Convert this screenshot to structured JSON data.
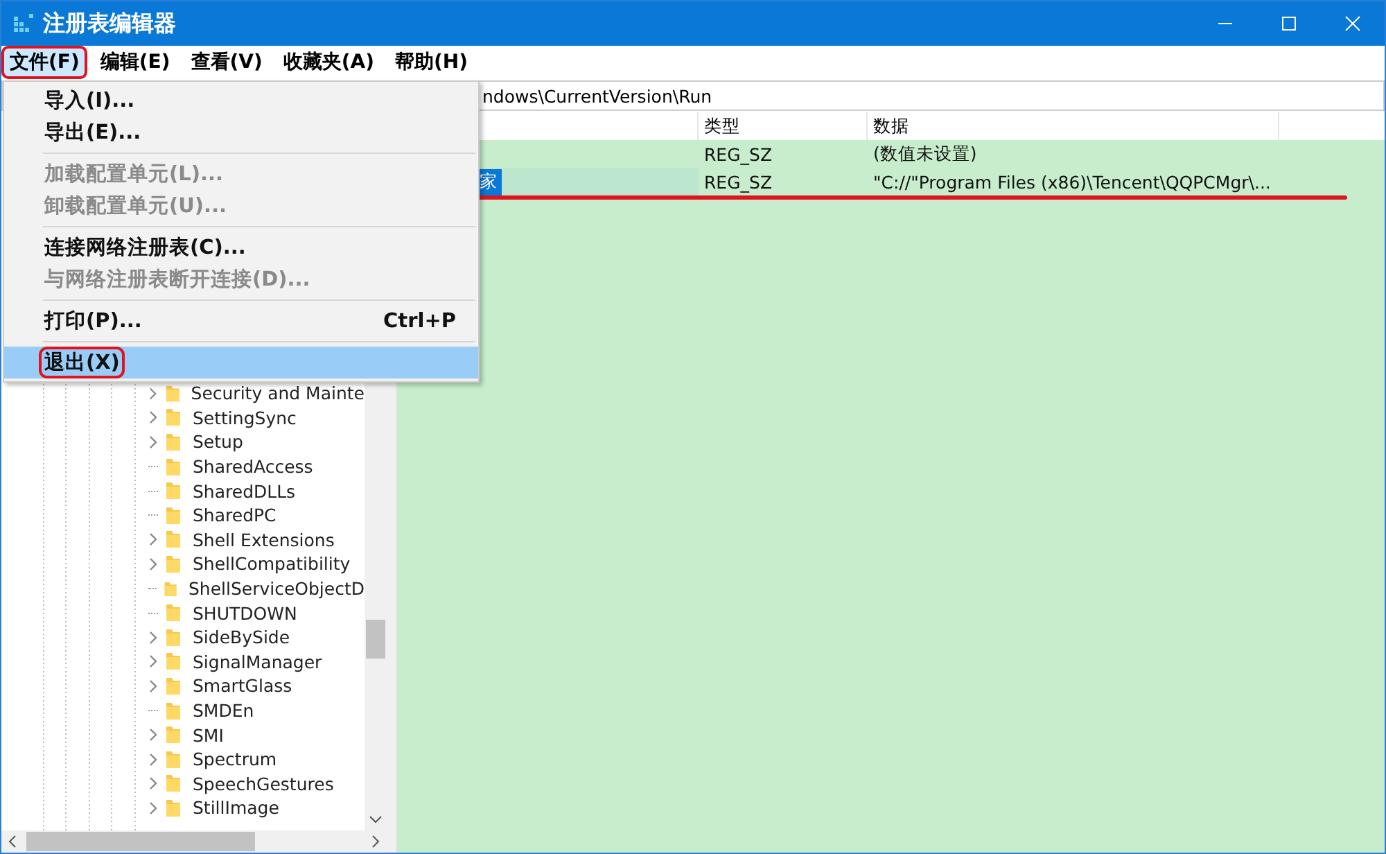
{
  "window": {
    "title": "注册表编辑器"
  },
  "menu_bar": [
    {
      "label": "文件(F)",
      "selected": true,
      "annotated": true
    },
    {
      "label": "编辑(E)",
      "selected": false,
      "annotated": false
    },
    {
      "label": "查看(V)",
      "selected": false,
      "annotated": false
    },
    {
      "label": "收藏夹(A)",
      "selected": false,
      "annotated": false
    },
    {
      "label": "帮助(H)",
      "selected": false,
      "annotated": false
    }
  ],
  "address_bar": {
    "value": "ndows\\CurrentVersion\\Run"
  },
  "tree": {
    "items": [
      {
        "label": "Security and Mainte",
        "expandable": true
      },
      {
        "label": "SettingSync",
        "expandable": true
      },
      {
        "label": "Setup",
        "expandable": true
      },
      {
        "label": "SharedAccess",
        "expandable": false
      },
      {
        "label": "SharedDLLs",
        "expandable": false
      },
      {
        "label": "SharedPC",
        "expandable": false
      },
      {
        "label": "Shell Extensions",
        "expandable": true
      },
      {
        "label": "ShellCompatibility",
        "expandable": true
      },
      {
        "label": "ShellServiceObjectD",
        "expandable": false
      },
      {
        "label": "SHUTDOWN",
        "expandable": false
      },
      {
        "label": "SideBySide",
        "expandable": true
      },
      {
        "label": "SignalManager",
        "expandable": true
      },
      {
        "label": "SmartGlass",
        "expandable": true
      },
      {
        "label": "SMDEn",
        "expandable": false
      },
      {
        "label": "SMI",
        "expandable": true
      },
      {
        "label": "Spectrum",
        "expandable": true
      },
      {
        "label": "SpeechGestures",
        "expandable": true
      },
      {
        "label": "StillImage",
        "expandable": true
      }
    ]
  },
  "values_table": {
    "columns": [
      "类型",
      "数据"
    ],
    "rows": [
      {
        "type": "REG_SZ",
        "data": "(数值未设置)"
      },
      {
        "name": "家",
        "type": "REG_SZ",
        "data": "\"C://\"Program Files (x86)\\Tencent\\QQPCMgr\\...",
        "selected": true,
        "annotated": true
      }
    ]
  },
  "file_menu": {
    "items": [
      {
        "kind": "item",
        "label": "导入(I)...",
        "disabled": false,
        "selected": false,
        "annotated": false
      },
      {
        "kind": "item",
        "label": "导出(E)...",
        "disabled": false,
        "selected": false,
        "annotated": false
      },
      {
        "kind": "separator"
      },
      {
        "kind": "item",
        "label": "加载配置单元(L)...",
        "disabled": true,
        "selected": false,
        "annotated": false
      },
      {
        "kind": "item",
        "label": "卸载配置单元(U)...",
        "disabled": true,
        "selected": false,
        "annotated": false
      },
      {
        "kind": "separator"
      },
      {
        "kind": "item",
        "label": "连接网络注册表(C)...",
        "disabled": false,
        "selected": false,
        "annotated": false
      },
      {
        "kind": "item",
        "label": "与网络注册表断开连接(D)...",
        "disabled": true,
        "selected": false,
        "annotated": false
      },
      {
        "kind": "separator"
      },
      {
        "kind": "item",
        "label": "打印(P)...",
        "shortcut": "Ctrl+P",
        "disabled": false,
        "selected": false,
        "annotated": false
      },
      {
        "kind": "separator"
      },
      {
        "kind": "item",
        "label": "退出(X)",
        "disabled": false,
        "selected": true,
        "annotated": true
      }
    ]
  }
}
